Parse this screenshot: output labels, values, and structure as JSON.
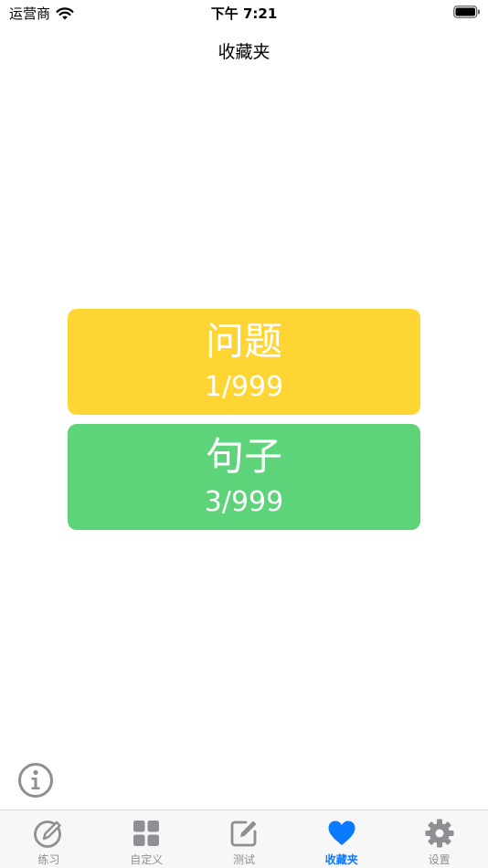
{
  "status_bar": {
    "carrier": "运营商",
    "time": "下午 7:21"
  },
  "nav": {
    "title": "收藏夹"
  },
  "categories": [
    {
      "title": "问题",
      "count": "1/999",
      "color": "#FED533"
    },
    {
      "title": "句子",
      "count": "3/999",
      "color": "#5ED47A"
    }
  ],
  "tabs": [
    {
      "label": "练习",
      "icon": "pencil-circle-icon"
    },
    {
      "label": "自定义",
      "icon": "grid-icon"
    },
    {
      "label": "测试",
      "icon": "edit-square-icon"
    },
    {
      "label": "收藏夹",
      "icon": "heart-icon",
      "active": true
    },
    {
      "label": "设置",
      "icon": "gear-icon"
    }
  ],
  "colors": {
    "active_tab": "#0A7AFF",
    "inactive_tab": "#8E8E93"
  }
}
